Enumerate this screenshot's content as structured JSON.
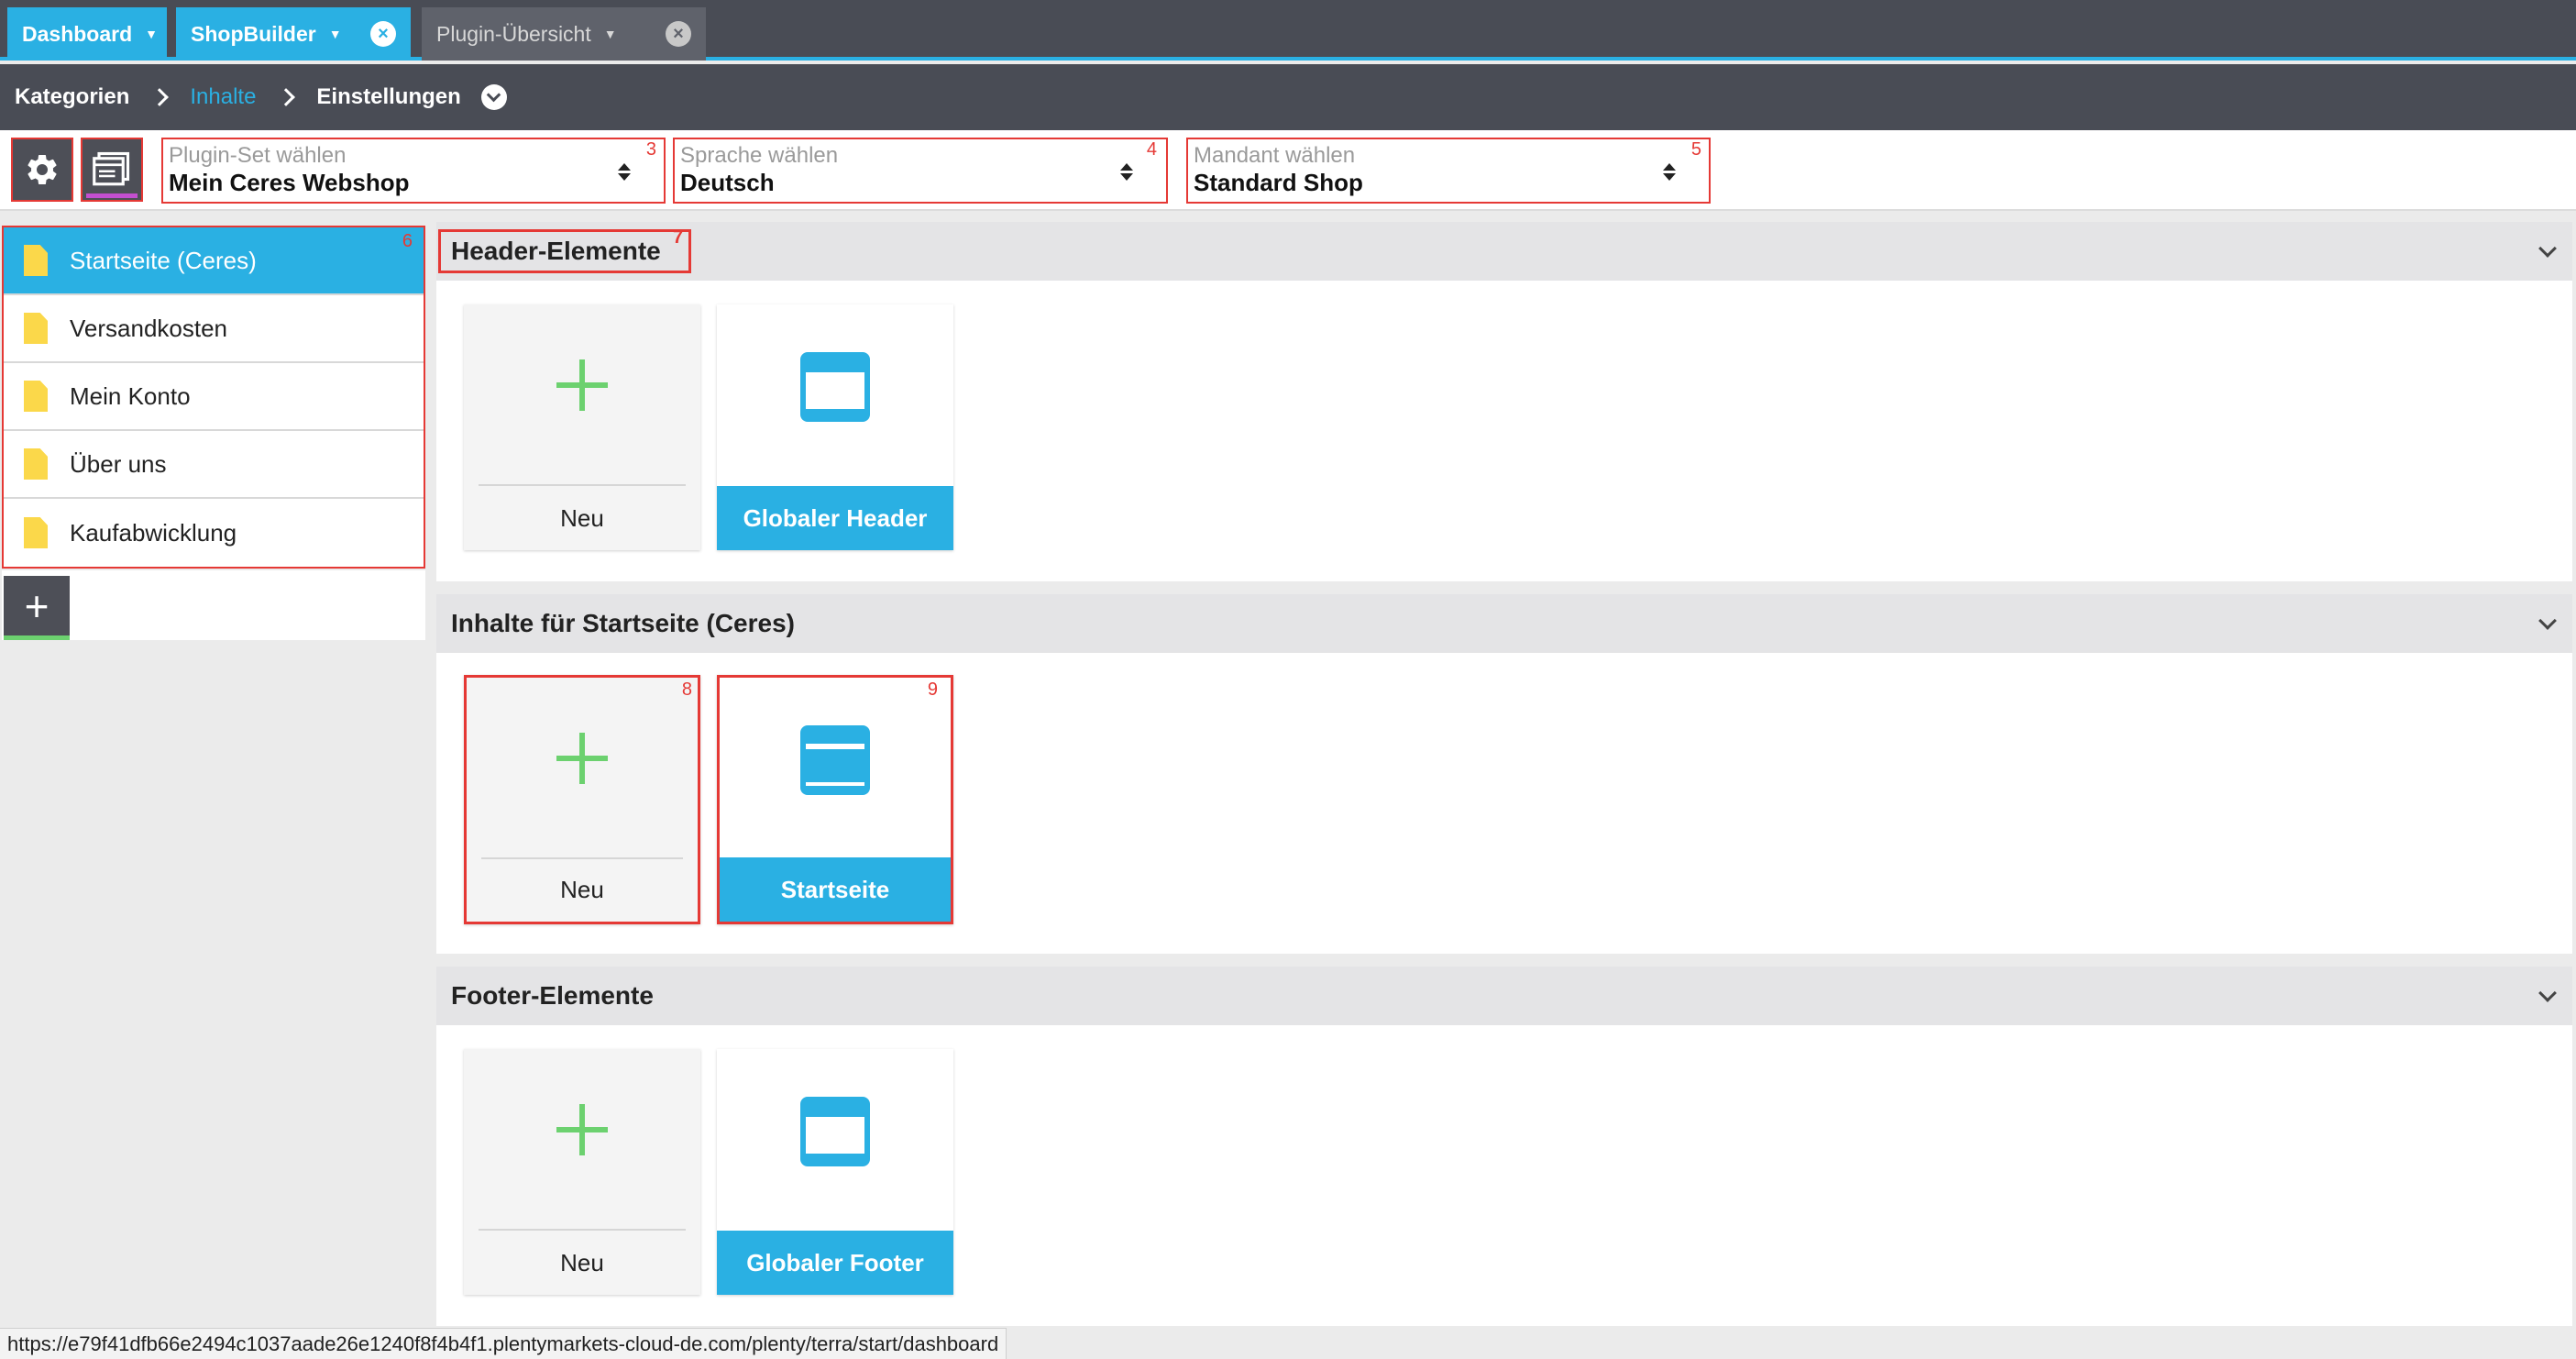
{
  "tabs": [
    {
      "label": "Dashboard",
      "active": true,
      "closable": false
    },
    {
      "label": "ShopBuilder",
      "active": true,
      "closable": true
    },
    {
      "label": "Plugin-Übersicht",
      "active": false,
      "closable": true
    }
  ],
  "breadcrumb": {
    "items": [
      "Kategorien",
      "Inhalte",
      "Einstellungen"
    ],
    "current": "Inhalte"
  },
  "toolbar": {
    "settings_icon": "gear-icon",
    "layout_icon": "layout-icon",
    "plugin_set": {
      "label": "Plugin-Set wählen",
      "value": "Mein Ceres Webshop",
      "marker": "3"
    },
    "language": {
      "label": "Sprache wählen",
      "value": "Deutsch",
      "marker": "4"
    },
    "client": {
      "label": "Mandant wählen",
      "value": "Standard Shop",
      "marker": "5"
    }
  },
  "sidebar": {
    "marker": "6",
    "pages": [
      {
        "label": "Startseite (Ceres)",
        "active": true
      },
      {
        "label": "Versandkosten",
        "active": false
      },
      {
        "label": "Mein Konto",
        "active": false
      },
      {
        "label": "Über uns",
        "active": false
      },
      {
        "label": "Kaufabwicklung",
        "active": false
      }
    ],
    "add_label": "+"
  },
  "sections": [
    {
      "title": "Header-Elemente",
      "marker": "7",
      "new_label": "Neu",
      "template_label": "Globaler Header"
    },
    {
      "title": "Inhalte für Startseite (Ceres)",
      "new_label": "Neu",
      "new_marker": "8",
      "template_label": "Startseite",
      "template_marker": "9"
    },
    {
      "title": "Footer-Elemente",
      "new_label": "Neu",
      "template_label": "Globaler Footer"
    }
  ],
  "status_url": "https://e79f41dfb66e2494c1037aade26e1240f8f4b4f1.plentymarkets-cloud-de.com/plenty/terra/start/dashboard",
  "colors": {
    "accent": "#2ab0e3",
    "dark": "#494c55",
    "annotation": "#e53935",
    "plus": "#6cd16f",
    "file": "#fbd84a"
  }
}
